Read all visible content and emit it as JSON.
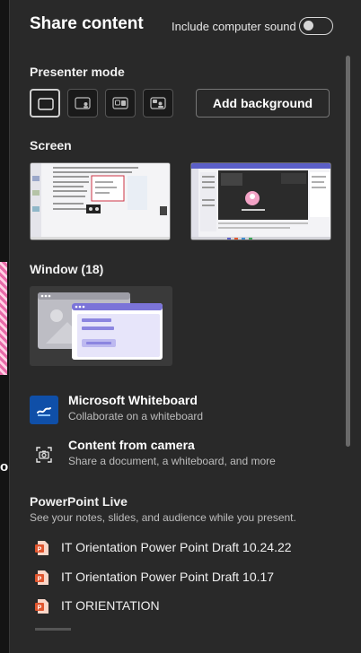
{
  "header": {
    "title": "Share content",
    "sound_label": "Include computer sound",
    "sound_toggle_on": false
  },
  "presenter_mode": {
    "title": "Presenter mode",
    "modes": [
      "content-only-icon",
      "standout-icon",
      "side-by-side-icon",
      "reporter-icon"
    ],
    "selected_index": 0,
    "add_background_label": "Add background"
  },
  "screen": {
    "title": "Screen",
    "thumbnails": [
      "screen-1",
      "screen-2"
    ]
  },
  "window": {
    "title": "Window (18)"
  },
  "apps": [
    {
      "title": "Microsoft Whiteboard",
      "subtitle": "Collaborate on a whiteboard",
      "icon": "whiteboard-icon",
      "color": "#0f4fa8"
    },
    {
      "title": "Content from camera",
      "subtitle": "Share a document, a whiteboard, and more",
      "icon": "camera-icon",
      "color": "#292929"
    }
  ],
  "powerpoint": {
    "title": "PowerPoint Live",
    "subtitle": "See your notes, slides, and audience while you present.",
    "files": [
      "IT Orientation Power Point Draft 10.24.22",
      "IT Orientation Power Point Draft 10.17",
      "IT ORIENTATION"
    ],
    "icon": "powerpoint-file-icon",
    "icon_color": "#e0552e"
  },
  "colors": {
    "panel_bg": "#292929",
    "accent_purple": "#7b74d8"
  }
}
